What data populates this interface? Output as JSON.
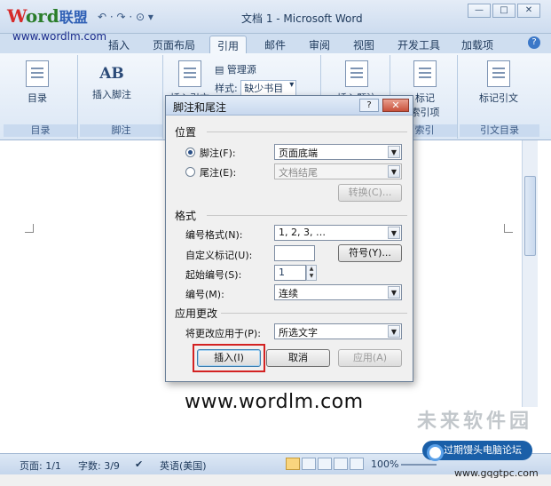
{
  "logo": {
    "w": "W",
    "rest": "ord",
    "cn": "联盟",
    "url": "www.wordlm.com"
  },
  "quick_access": "↶ · ↷ ·  ⊙ ▾",
  "window": {
    "title": "文档 1 - Microsoft Word",
    "min": "—",
    "max": "□",
    "close": "✕"
  },
  "ribbon_tabs": [
    "插入",
    "页面布局",
    "引用",
    "邮件",
    "审阅",
    "视图",
    "开发工具",
    "加载项"
  ],
  "active_tab": "引用",
  "help_icon": "?",
  "ribbon": {
    "toc_label": "目录",
    "toc_group": "目录",
    "insert_footnote": "插入脚注",
    "footnote_group": "脚注",
    "manage_sources": "管理源",
    "style_label": "样式:",
    "style_value": "缺少书目",
    "insert_citation": "插入引文",
    "insert_caption": "插入题注",
    "mark_entry": "标记",
    "mark_entry2": "索引项",
    "index_group": "索引",
    "mark_citation": "标记引文",
    "toa_group": "引文目录",
    "ab_text": "AB"
  },
  "dialog": {
    "title": "脚注和尾注",
    "help": "?",
    "close": "✕",
    "location_section": "位置",
    "footnote_label": "脚注(F):",
    "footnote_value": "页面底端",
    "endnote_label": "尾注(E):",
    "endnote_value": "文档结尾",
    "convert_button": "转换(C)...",
    "format_section": "格式",
    "number_format_label": "编号格式(N):",
    "number_format_value": "1, 2, 3, …",
    "custom_mark_label": "自定义标记(U):",
    "custom_mark_value": "",
    "symbol_button": "符号(Y)...",
    "start_at_label": "起始编号(S):",
    "start_at_value": "1",
    "numbering_label": "编号(M):",
    "numbering_value": "连续",
    "apply_section": "应用更改",
    "apply_to_label": "将更改应用于(P):",
    "apply_to_value": "所选文字",
    "insert_button": "插入(I)",
    "cancel_button": "取消",
    "apply_button": "应用(A)"
  },
  "document": {
    "watermark_url": "www.wordlm.com",
    "cn_watermark": "未来软件园"
  },
  "statusbar": {
    "page": "页面: 1/1",
    "words": "字数: 3/9",
    "language": "英语(美国)",
    "zoom": "100%"
  },
  "overlay": {
    "badge": "过期馒头电脑论坛",
    "site": "www.gqgtpc.com"
  }
}
